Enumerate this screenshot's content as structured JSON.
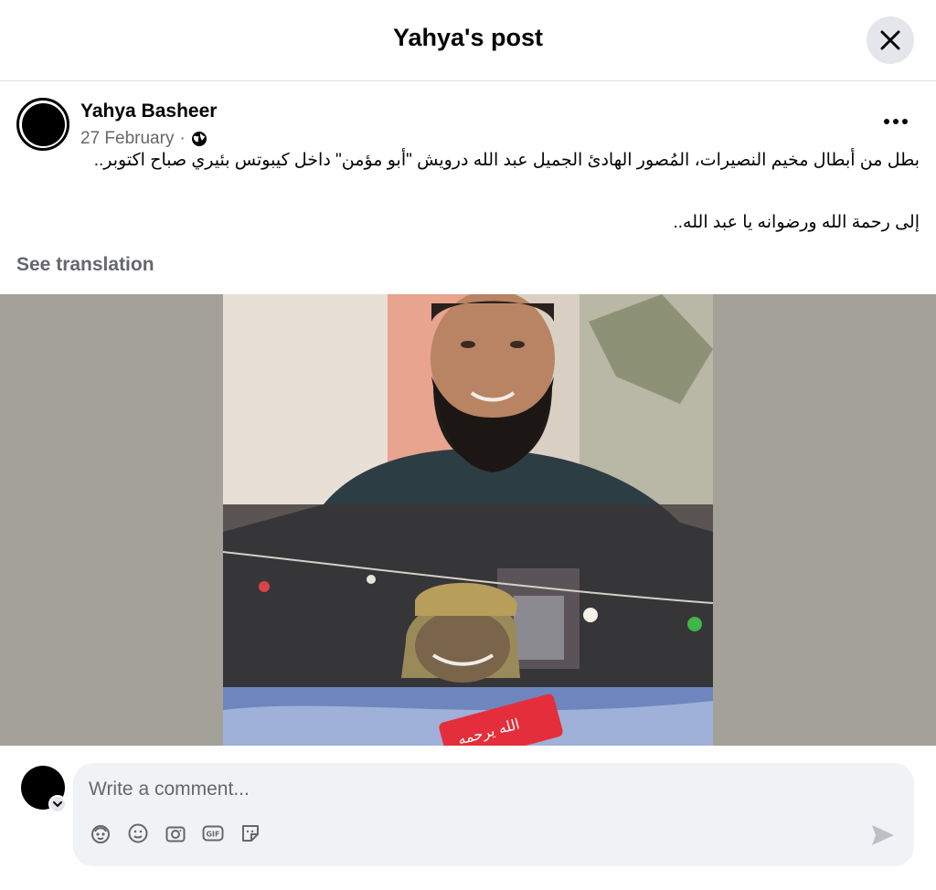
{
  "header": {
    "title": "Yahya's post",
    "close_icon": "close-icon"
  },
  "post": {
    "author": "Yahya Basheer",
    "date": "27 February",
    "separator": "·",
    "audience_icon": "globe-icon",
    "more_icon": "more-horizontal-icon",
    "text_line_1": "بطل من أبطال مخيم النصيرات، المُصور الهادئ الجميل عبد الله درويش \"أبو مؤمن\" داخل كيبوتس بئيري صباح اكتوبر..",
    "text_line_2": "إلى رحمة الله ورضوانه يا عبد الله..",
    "see_translation": "See translation",
    "image_overlay_text": "الله يرحمه"
  },
  "composer": {
    "placeholder": "Write a comment...",
    "tools": [
      "avatar-sticker-icon",
      "emoji-icon",
      "camera-icon",
      "gif-icon",
      "sticker-icon"
    ],
    "send_icon": "send-icon"
  },
  "colors": {
    "secondary_text": "#65676b",
    "close_bg": "#e4e6eb",
    "comment_bg": "#f0f2f5",
    "media_bg": "#a3a198"
  }
}
